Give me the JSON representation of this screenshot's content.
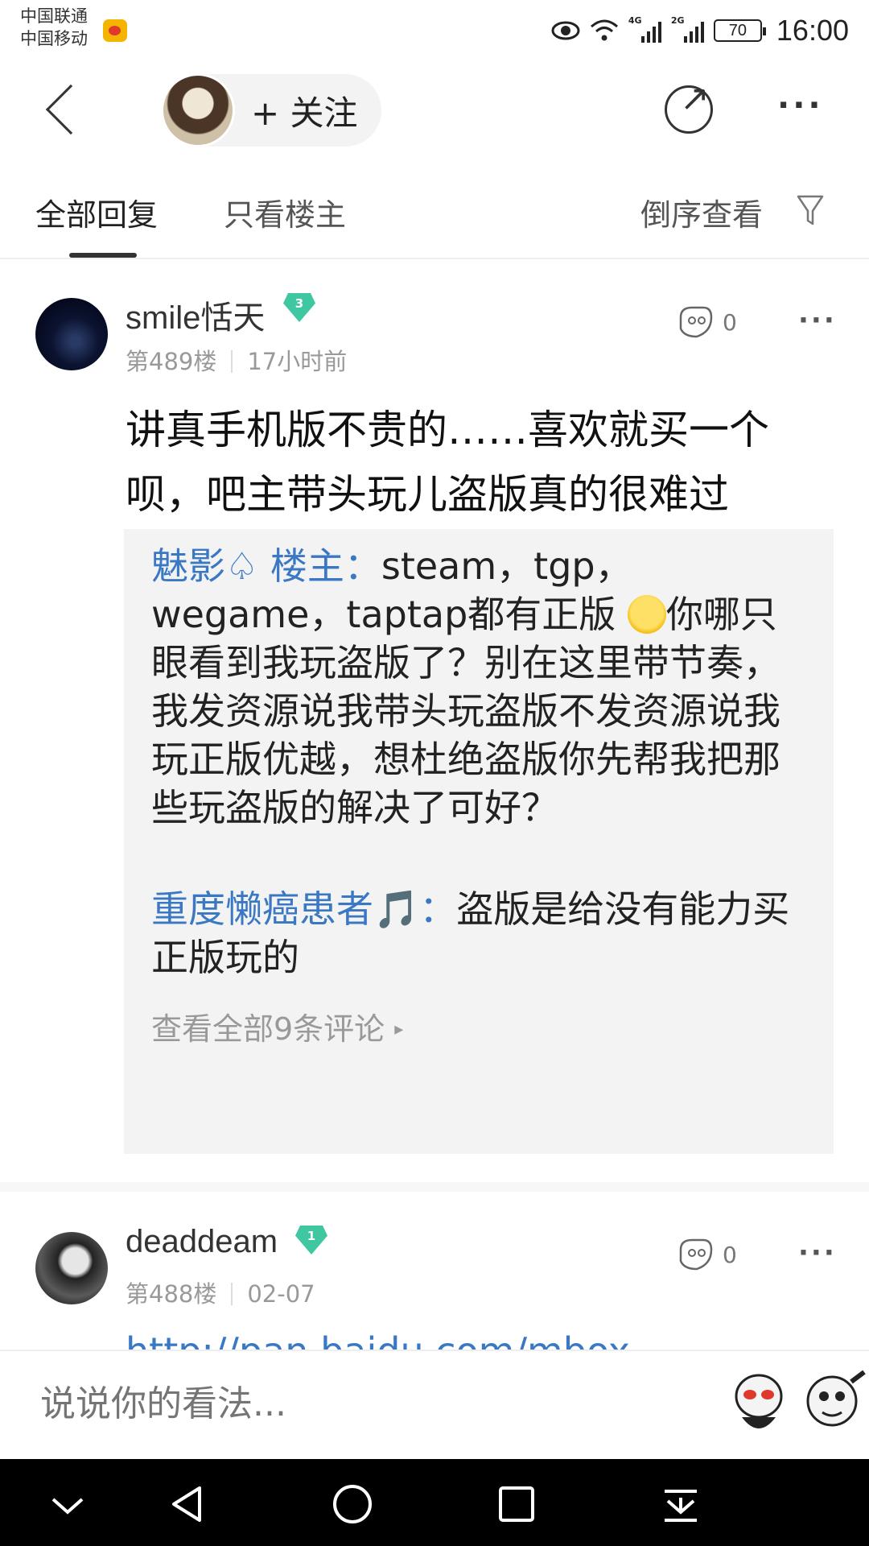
{
  "status_bar": {
    "carrier1": "中国联通",
    "carrier2": "中国移动",
    "net1": "4G",
    "net2": "2G",
    "battery": "70",
    "time": "16:00"
  },
  "header": {
    "follow_label": "+ 关注"
  },
  "tabs": {
    "all_replies": "全部回复",
    "only_op": "只看楼主",
    "reverse": "倒序查看"
  },
  "posts": [
    {
      "username": "smile恬天",
      "level": "3",
      "floor": "第489楼",
      "time": "17小时前",
      "likes": "0",
      "content_line1": "讲真手机版不贵的……喜欢就买一个",
      "content_line2": "呗，吧主带头玩儿盗版真的很难过",
      "replies": [
        {
          "author": "魅影♤ 楼主：",
          "text_a": "steam，tgp，wegame，taptap都有正版",
          "text_b": "你哪只眼看到我玩盗版了？别在这里带节奏，我发资源说我带头玩盗版不发资源说我玩正版优越，想杜绝盗版你先帮我把那些玩盗版的解决了可好？"
        },
        {
          "author": "重度懒癌患者🎵：",
          "text_a": "盗版是给没有能力买正版玩的",
          "text_b": ""
        }
      ],
      "view_all": "查看全部9条评论"
    },
    {
      "username": "deaddeam",
      "level": "1",
      "floor": "第488楼",
      "time": "02-07",
      "likes": "0",
      "link_peek": "http://pan.baidu.com/mbox"
    }
  ],
  "comment_bar": {
    "placeholder": "说说你的看法..."
  },
  "icons": {
    "accent": "#3a78c4",
    "badge": "#3fc7a1"
  }
}
